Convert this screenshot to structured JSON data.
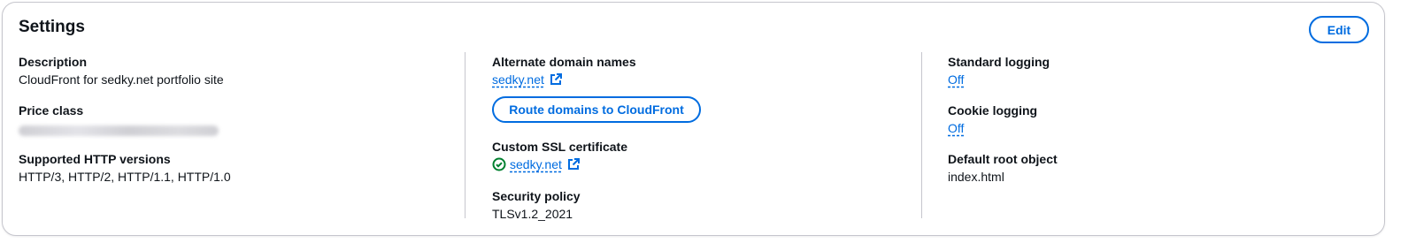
{
  "panel": {
    "title": "Settings",
    "edit_label": "Edit"
  },
  "col1": {
    "description_label": "Description",
    "description_value": "CloudFront for sedky.net portfolio site",
    "price_class_label": "Price class",
    "price_class_value_redacted": true,
    "http_versions_label": "Supported HTTP versions",
    "http_versions_value": "HTTP/3, HTTP/2, HTTP/1.1, HTTP/1.0"
  },
  "col2": {
    "alt_domains_label": "Alternate domain names",
    "alt_domains_value": "sedky.net",
    "route_button_label": "Route domains to CloudFront",
    "ssl_label": "Custom SSL certificate",
    "ssl_value": "sedky.net",
    "ssl_status_icon": "check-circle-icon",
    "ssl_status_color": "#00802f",
    "security_policy_label": "Security policy",
    "security_policy_value": "TLSv1.2_2021"
  },
  "col3": {
    "standard_logging_label": "Standard logging",
    "standard_logging_value": "Off",
    "cookie_logging_label": "Cookie logging",
    "cookie_logging_value": "Off",
    "default_root_label": "Default root object",
    "default_root_value": "index.html"
  },
  "colors": {
    "accent": "#006ce0",
    "text": "#0f141a",
    "border": "#c6c6cd"
  }
}
